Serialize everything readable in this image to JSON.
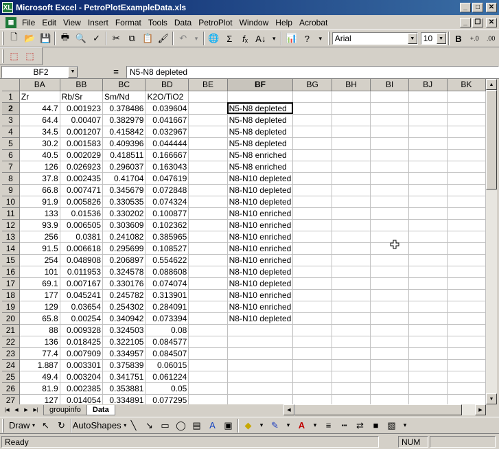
{
  "window": {
    "title": "Microsoft Excel - PetroPlotExampleData.xls",
    "app_icon": "XL"
  },
  "menu": [
    "File",
    "Edit",
    "View",
    "Insert",
    "Format",
    "Tools",
    "Data",
    "PetroPlot",
    "Window",
    "Help",
    "Acrobat"
  ],
  "font": {
    "name": "Arial",
    "size": "10",
    "bold": "B",
    "inc_decimal": "+.0\n.00",
    "dec_decimal": ".00\n+.0"
  },
  "formula_bar": {
    "name_box": "BF2",
    "equals": "=",
    "content": "N5-N8 depleted"
  },
  "columns": [
    "BA",
    "BB",
    "BC",
    "BD",
    "BE",
    "BF",
    "BG",
    "BH",
    "BI",
    "BJ",
    "BK"
  ],
  "rows": [
    [
      "1",
      "Zr",
      "Rb/Sr",
      "Sm/Nd",
      "K2O/TiO2",
      "",
      ""
    ],
    [
      "2",
      "44.7",
      "0.001923",
      "0.378486",
      "0.039604",
      "",
      "N5-N8 depleted"
    ],
    [
      "3",
      "64.4",
      "0.00407",
      "0.382979",
      "0.041667",
      "",
      "N5-N8 depleted"
    ],
    [
      "4",
      "34.5",
      "0.001207",
      "0.415842",
      "0.032967",
      "",
      "N5-N8 depleted"
    ],
    [
      "5",
      "30.2",
      "0.001583",
      "0.409396",
      "0.044444",
      "",
      "N5-N8 depleted"
    ],
    [
      "6",
      "40.5",
      "0.002029",
      "0.418511",
      "0.166667",
      "",
      "N5-N8 enriched"
    ],
    [
      "7",
      "126",
      "0.026923",
      "0.296037",
      "0.163043",
      "",
      "N5-N8 enriched"
    ],
    [
      "8",
      "37.8",
      "0.002435",
      "0.41704",
      "0.047619",
      "",
      "N8-N10 depleted"
    ],
    [
      "9",
      "66.8",
      "0.007471",
      "0.345679",
      "0.072848",
      "",
      "N8-N10 depleted"
    ],
    [
      "10",
      "91.9",
      "0.005826",
      "0.330535",
      "0.074324",
      "",
      "N8-N10 depleted"
    ],
    [
      "11",
      "133",
      "0.01536",
      "0.330202",
      "0.100877",
      "",
      "N8-N10 enriched"
    ],
    [
      "12",
      "93.9",
      "0.006505",
      "0.303609",
      "0.102362",
      "",
      "N8-N10 enriched"
    ],
    [
      "13",
      "256",
      "0.0381",
      "0.241082",
      "0.385965",
      "",
      "N8-N10 enriched"
    ],
    [
      "14",
      "91.5",
      "0.006618",
      "0.295699",
      "0.108527",
      "",
      "N8-N10 enriched"
    ],
    [
      "15",
      "254",
      "0.048908",
      "0.206897",
      "0.554622",
      "",
      "N8-N10 enriched"
    ],
    [
      "16",
      "101",
      "0.011953",
      "0.324578",
      "0.088608",
      "",
      "N8-N10 depleted"
    ],
    [
      "17",
      "69.1",
      "0.007167",
      "0.330176",
      "0.074074",
      "",
      "N8-N10 depleted"
    ],
    [
      "18",
      "177",
      "0.045241",
      "0.245782",
      "0.313901",
      "",
      "N8-N10 enriched"
    ],
    [
      "19",
      "129",
      "0.03654",
      "0.254302",
      "0.284091",
      "",
      "N8-N10 enriched"
    ],
    [
      "20",
      "65.8",
      "0.00254",
      "0.340942",
      "0.073394",
      "",
      "N8-N10 depleted"
    ],
    [
      "21",
      "88",
      "0.009328",
      "0.324503",
      "0.08",
      "",
      ""
    ],
    [
      "22",
      "136",
      "0.018425",
      "0.322105",
      "0.084577",
      "",
      ""
    ],
    [
      "23",
      "77.4",
      "0.007909",
      "0.334957",
      "0.084507",
      "",
      ""
    ],
    [
      "24",
      "1.887",
      "0.003301",
      "0.375839",
      "0.06015",
      "",
      ""
    ],
    [
      "25",
      "49.4",
      "0.003204",
      "0.341751",
      "0.061224",
      "",
      ""
    ],
    [
      "26",
      "81.9",
      "0.002385",
      "0.353881",
      "0.05",
      "",
      ""
    ],
    [
      "27",
      "127",
      "0.014054",
      "0.334891",
      "0.077295",
      "",
      ""
    ]
  ],
  "sheets": [
    "groupinfo",
    "Data"
  ],
  "draw_toolbar": {
    "draw": "Draw",
    "autoshapes": "AutoShapes"
  },
  "status": {
    "ready": "Ready",
    "num": "NUM"
  }
}
